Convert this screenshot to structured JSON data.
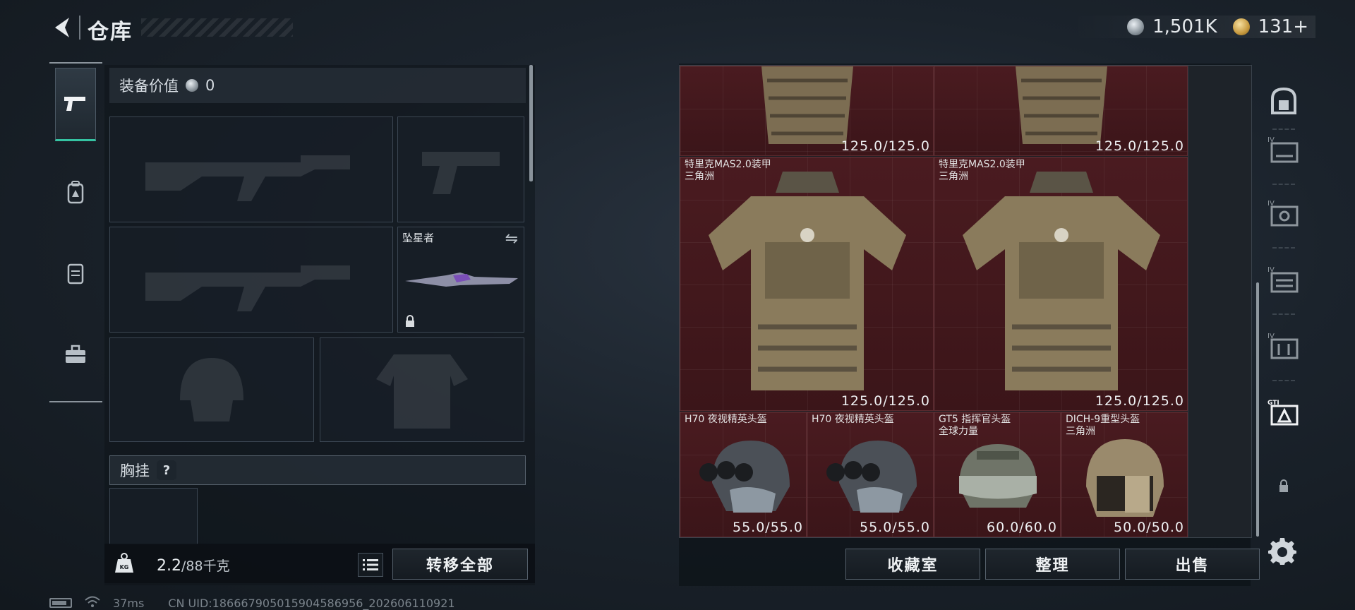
{
  "header": {
    "title": "仓库"
  },
  "currency": {
    "silver": "1,501K",
    "gold": "131+"
  },
  "equipment": {
    "value_label": "装备价值",
    "value": "0",
    "melee_name": "坠星者",
    "chest_label": "胸挂",
    "help": "?"
  },
  "capacity": {
    "current": "2.2",
    "max": "/88千克"
  },
  "actions": {
    "transfer_all": "转移全部",
    "collection": "收藏室",
    "organize": "整理",
    "sell": "出售"
  },
  "status": {
    "ping": "37ms",
    "uid": "CN UID:1866679050159045869​56_202606110921"
  },
  "stash_items": [
    {
      "name": "",
      "subtitle": "",
      "durability": "125.0/125.0"
    },
    {
      "name": "",
      "subtitle": "",
      "durability": "125.0/125.0"
    },
    {
      "name": "特里克MAS2.0装甲",
      "subtitle": "三角洲",
      "durability": "125.0/125.0"
    },
    {
      "name": "特里克MAS2.0装甲",
      "subtitle": "三角洲",
      "durability": "125.0/125.0"
    },
    {
      "name": "H70 夜视精英头盔",
      "subtitle": "",
      "durability": "55.0/55.0"
    },
    {
      "name": "H70 夜视精英头盔",
      "subtitle": "",
      "durability": "55.0/55.0"
    },
    {
      "name": "GT5 指挥官头盔",
      "subtitle": "全球力量",
      "durability": "60.0/60.0"
    },
    {
      "name": "DICH-9重型头盔",
      "subtitle": "三角洲",
      "durability": "50.0/50.0"
    }
  ],
  "colors": {
    "accent": "#35c3a2",
    "cell": "#4a1b20"
  },
  "icons": {
    "categories": [
      "pistol-icon",
      "backpack-icon",
      "chest-rig-icon",
      "toolbox-icon"
    ],
    "sidebar": [
      "safe-icon",
      "tier4-case-icon",
      "tier4-case-icon",
      "tier4-case-icon",
      "tier4-case-icon",
      "gti-case-icon",
      "lock-icon"
    ]
  }
}
